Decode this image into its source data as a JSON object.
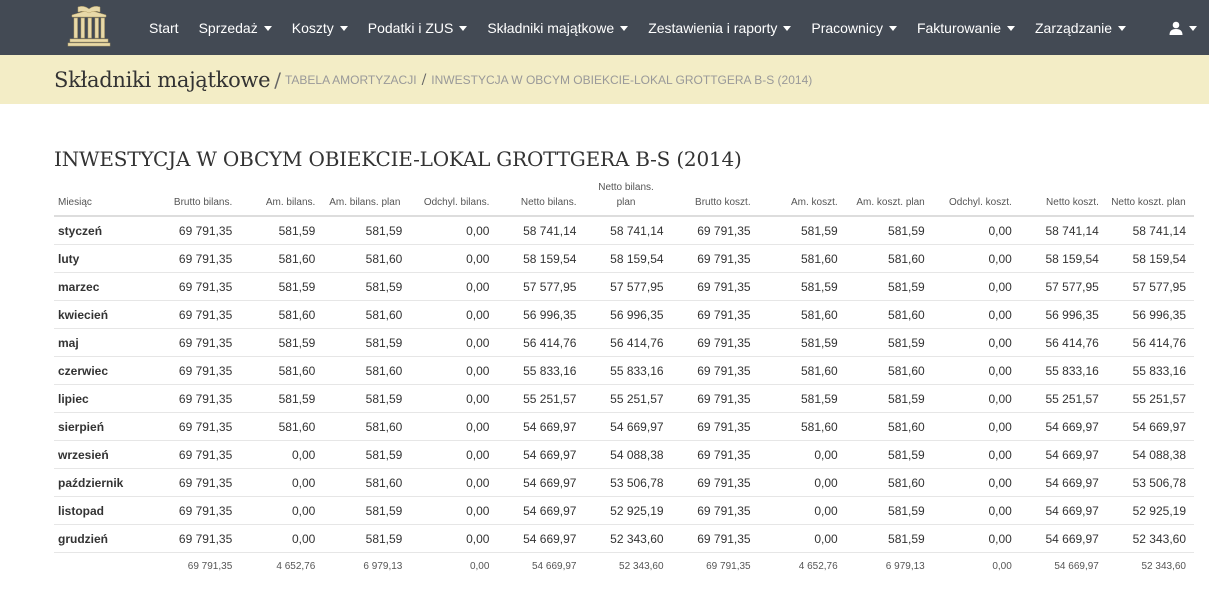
{
  "nav": {
    "items": [
      {
        "label": "Start",
        "dropdown": false
      },
      {
        "label": "Sprzedaż",
        "dropdown": true
      },
      {
        "label": "Koszty",
        "dropdown": true
      },
      {
        "label": "Podatki i ZUS",
        "dropdown": true
      },
      {
        "label": "Składniki majątkowe",
        "dropdown": true
      },
      {
        "label": "Zestawienia i raporty",
        "dropdown": true
      },
      {
        "label": "Pracownicy",
        "dropdown": true
      },
      {
        "label": "Fakturowanie",
        "dropdown": true
      },
      {
        "label": "Zarządzanie",
        "dropdown": true
      }
    ],
    "user_icon": "user-icon"
  },
  "breadcrumb": {
    "title": "Składniki majątkowe",
    "separator": "/",
    "link": "TABELA AMORTYZACJI",
    "current": "INWESTYCJA W OBCYM OBIEKCIE-LOKAL GROTTGERA B-S (2014)"
  },
  "page_title": "INWESTYCJA W OBCYM OBIEKCIE-LOKAL GROTTGERA B-S (2014)",
  "table": {
    "headers": [
      "Miesiąc",
      "Brutto bilans.",
      "Am. bilans.",
      "Am. bilans. plan",
      "Odchyl. bilans.",
      "Netto bilans.",
      "Netto bilans. plan",
      "Brutto koszt.",
      "Am. koszt.",
      "Am. koszt. plan",
      "Odchyl. koszt.",
      "Netto koszt.",
      "Netto koszt. plan"
    ],
    "rows": [
      [
        "styczeń",
        "69 791,35",
        "581,59",
        "581,59",
        "0,00",
        "58 741,14",
        "58 741,14",
        "69 791,35",
        "581,59",
        "581,59",
        "0,00",
        "58 741,14",
        "58 741,14"
      ],
      [
        "luty",
        "69 791,35",
        "581,60",
        "581,60",
        "0,00",
        "58 159,54",
        "58 159,54",
        "69 791,35",
        "581,60",
        "581,60",
        "0,00",
        "58 159,54",
        "58 159,54"
      ],
      [
        "marzec",
        "69 791,35",
        "581,59",
        "581,59",
        "0,00",
        "57 577,95",
        "57 577,95",
        "69 791,35",
        "581,59",
        "581,59",
        "0,00",
        "57 577,95",
        "57 577,95"
      ],
      [
        "kwiecień",
        "69 791,35",
        "581,60",
        "581,60",
        "0,00",
        "56 996,35",
        "56 996,35",
        "69 791,35",
        "581,60",
        "581,60",
        "0,00",
        "56 996,35",
        "56 996,35"
      ],
      [
        "maj",
        "69 791,35",
        "581,59",
        "581,59",
        "0,00",
        "56 414,76",
        "56 414,76",
        "69 791,35",
        "581,59",
        "581,59",
        "0,00",
        "56 414,76",
        "56 414,76"
      ],
      [
        "czerwiec",
        "69 791,35",
        "581,60",
        "581,60",
        "0,00",
        "55 833,16",
        "55 833,16",
        "69 791,35",
        "581,60",
        "581,60",
        "0,00",
        "55 833,16",
        "55 833,16"
      ],
      [
        "lipiec",
        "69 791,35",
        "581,59",
        "581,59",
        "0,00",
        "55 251,57",
        "55 251,57",
        "69 791,35",
        "581,59",
        "581,59",
        "0,00",
        "55 251,57",
        "55 251,57"
      ],
      [
        "sierpień",
        "69 791,35",
        "581,60",
        "581,60",
        "0,00",
        "54 669,97",
        "54 669,97",
        "69 791,35",
        "581,60",
        "581,60",
        "0,00",
        "54 669,97",
        "54 669,97"
      ],
      [
        "wrzesień",
        "69 791,35",
        "0,00",
        "581,59",
        "0,00",
        "54 669,97",
        "54 088,38",
        "69 791,35",
        "0,00",
        "581,59",
        "0,00",
        "54 669,97",
        "54 088,38"
      ],
      [
        "październik",
        "69 791,35",
        "0,00",
        "581,60",
        "0,00",
        "54 669,97",
        "53 506,78",
        "69 791,35",
        "0,00",
        "581,60",
        "0,00",
        "54 669,97",
        "53 506,78"
      ],
      [
        "listopad",
        "69 791,35",
        "0,00",
        "581,59",
        "0,00",
        "54 669,97",
        "52 925,19",
        "69 791,35",
        "0,00",
        "581,59",
        "0,00",
        "54 669,97",
        "52 925,19"
      ],
      [
        "grudzień",
        "69 791,35",
        "0,00",
        "581,59",
        "0,00",
        "54 669,97",
        "52 343,60",
        "69 791,35",
        "0,00",
        "581,59",
        "0,00",
        "54 669,97",
        "52 343,60"
      ]
    ],
    "totals": [
      "",
      "69 791,35",
      "4 652,76",
      "6 979,13",
      "0,00",
      "54 669,97",
      "52 343,60",
      "69 791,35",
      "4 652,76",
      "6 979,13",
      "0,00",
      "54 669,97",
      "52 343,60"
    ]
  }
}
